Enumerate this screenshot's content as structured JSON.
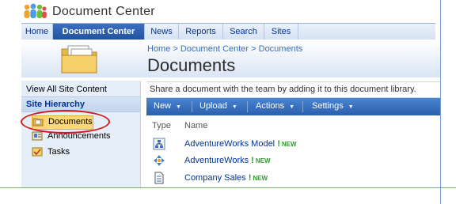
{
  "site": {
    "title": "Document Center"
  },
  "tabs": [
    {
      "label": "Home"
    },
    {
      "label": "Document Center"
    },
    {
      "label": "News"
    },
    {
      "label": "Reports"
    },
    {
      "label": "Search"
    },
    {
      "label": "Sites"
    }
  ],
  "header": {
    "breadcrumb": "Home > Document Center > Documents",
    "title": "Documents"
  },
  "leftnav": {
    "view_all": "View All Site Content",
    "section": "Site Hierarchy",
    "items": [
      {
        "label": "Documents",
        "icon": "document-library-icon",
        "selected": true
      },
      {
        "label": "Announcements",
        "icon": "announcements-icon"
      },
      {
        "label": "Tasks",
        "icon": "tasks-icon"
      }
    ]
  },
  "library": {
    "description": "Share a document with the team by adding it to this document library.",
    "toolbar": {
      "new": "New",
      "upload": "Upload",
      "actions": "Actions",
      "settings": "Settings"
    },
    "columns": {
      "type": "Type",
      "name": "Name"
    },
    "rows": [
      {
        "name": "AdventureWorks Model",
        "new": "NEW",
        "icon": "report-model-icon"
      },
      {
        "name": "AdventureWorks",
        "new": "NEW",
        "icon": "data-source-icon"
      },
      {
        "name": "Company Sales",
        "new": "NEW",
        "icon": "report-icon"
      }
    ]
  },
  "colors": {
    "accent": "#21529e",
    "link": "#003399",
    "new_badge": "#2e9b2e",
    "highlight": "#fcd67a",
    "annotation": "#d11a1a"
  }
}
